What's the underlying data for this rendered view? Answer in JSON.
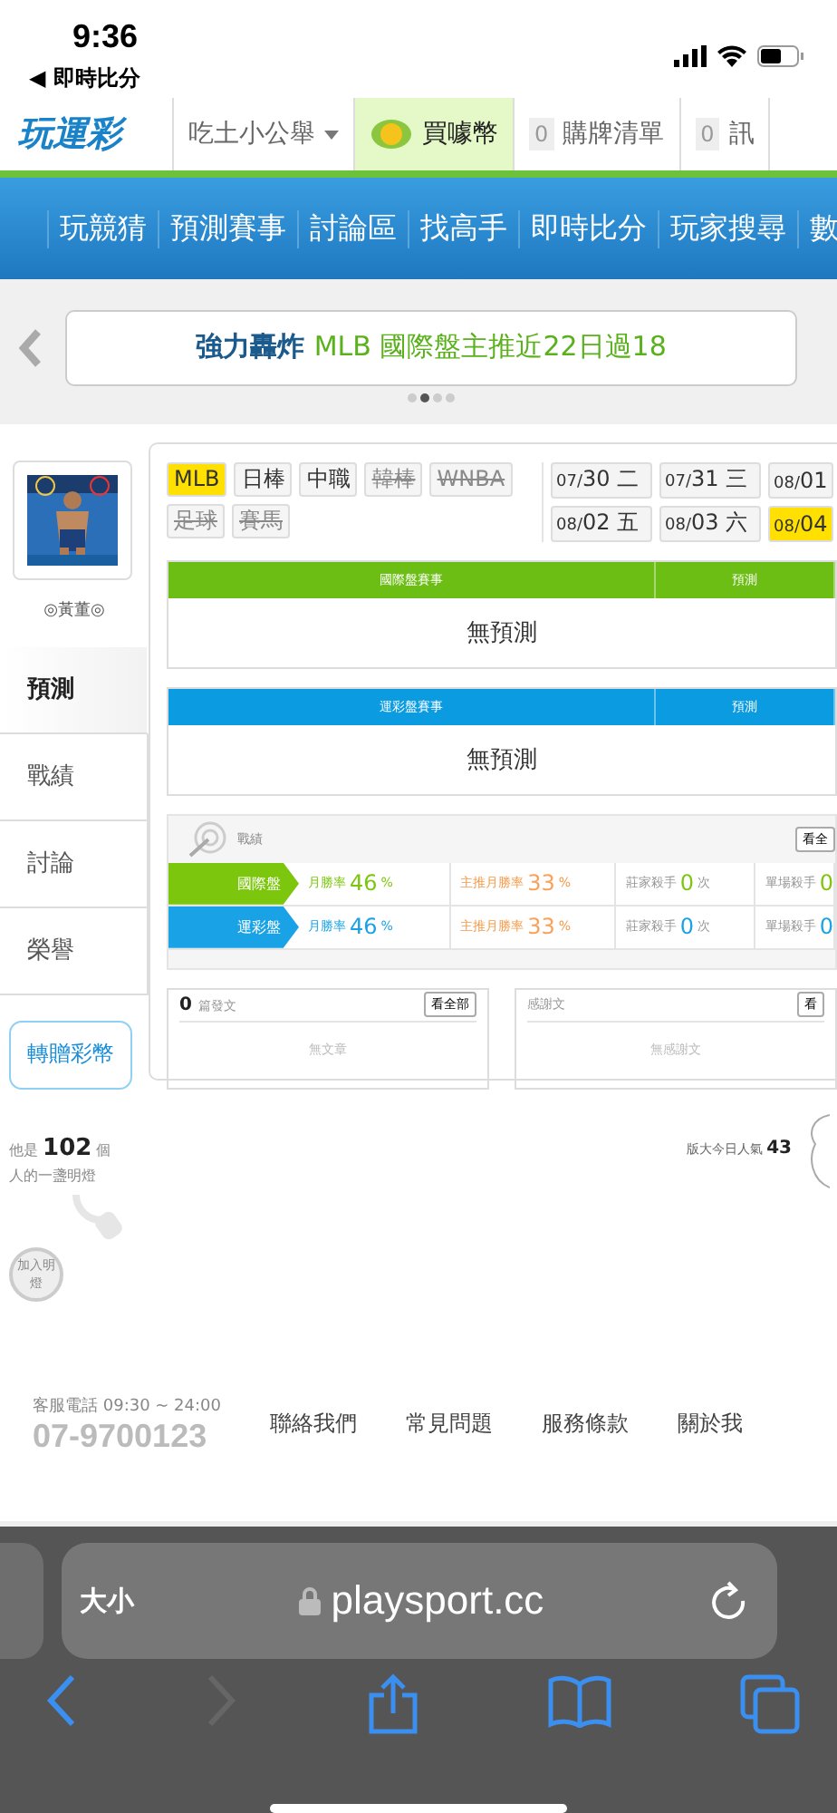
{
  "status_bar": {
    "time": "9:36",
    "back_link": "◀ 即時比分"
  },
  "top_nav": {
    "logo": "玩運彩",
    "user_menu": "吃土小公舉",
    "buy_coins": "買噱幣",
    "items": [
      {
        "count": "0",
        "label": "購牌清單"
      },
      {
        "count": "0",
        "label": "訊"
      }
    ]
  },
  "main_menu": [
    "玩競猜",
    "預測賽事",
    "討論區",
    "找高手",
    "即時比分",
    "玩家搜尋",
    "數"
  ],
  "banner": {
    "lead": "強力轟炸",
    "highlight": "MLB 國際盤主推近22日過18",
    "pages": [
      {
        "selected": false
      },
      {
        "selected": true
      },
      {
        "selected": false
      },
      {
        "selected": false
      }
    ]
  },
  "profile": {
    "name": "◎黃董◎",
    "tabs": [
      {
        "label": "預測",
        "selected": true
      },
      {
        "label": "戰績",
        "selected": false
      },
      {
        "label": "討論",
        "selected": false
      },
      {
        "label": "榮譽",
        "selected": false
      }
    ],
    "gift_button": "轉贈彩幣",
    "fans_prefix": "他是",
    "fans_count": "102",
    "fans_unit": "個",
    "fans_suffix": "人的一盞明燈",
    "follow_button": "加入明燈"
  },
  "leagues": [
    {
      "label": "MLB",
      "selected": true,
      "disabled": false
    },
    {
      "label": "日棒",
      "selected": false,
      "disabled": false
    },
    {
      "label": "中職",
      "selected": false,
      "disabled": false
    },
    {
      "label": "韓棒",
      "selected": false,
      "disabled": true
    },
    {
      "label": "WNBA",
      "selected": false,
      "disabled": true
    },
    {
      "label": "足球",
      "selected": false,
      "disabled": true
    },
    {
      "label": "賽馬",
      "selected": false,
      "disabled": true
    }
  ],
  "dates": [
    {
      "month": "07/",
      "day": "30",
      "weekday": "二",
      "selected": false
    },
    {
      "month": "07/",
      "day": "31",
      "weekday": "三",
      "selected": false
    },
    {
      "month": "08/",
      "day": "01",
      "selected": false
    },
    {
      "month": "08/",
      "day": "02",
      "weekday": "五",
      "selected": false
    },
    {
      "month": "08/",
      "day": "03",
      "weekday": "六",
      "selected": false
    },
    {
      "month": "08/",
      "day": "04",
      "selected": true
    }
  ],
  "prediction_tables": [
    {
      "title": "國際盤賽事",
      "column_2": "預測",
      "empty": "無預測",
      "color": "#6cbd14"
    },
    {
      "title": "運彩盤賽事",
      "column_2": "預測",
      "empty": "無預測",
      "color": "#0a9be0"
    }
  ],
  "record": {
    "title": "戰績",
    "view_all": "看全",
    "rows": [
      {
        "label": "國際盤",
        "color": "#7cc70e",
        "cells": [
          {
            "label": "月勝率",
            "value": "46",
            "unit": "%"
          },
          {
            "label": "主推月勝率",
            "value": "33",
            "unit": "%"
          },
          {
            "label": "莊家殺手",
            "value": "0",
            "unit": "次"
          },
          {
            "label": "單場殺手",
            "value": "0"
          }
        ]
      },
      {
        "label": "運彩盤",
        "color": "#1aa2e6",
        "cells": [
          {
            "label": "月勝率",
            "value": "46",
            "unit": "%"
          },
          {
            "label": "主推月勝率",
            "value": "33",
            "unit": "%"
          },
          {
            "label": "莊家殺手",
            "value": "0",
            "unit": "次"
          },
          {
            "label": "單場殺手",
            "value": "0"
          }
        ]
      }
    ]
  },
  "posts": [
    {
      "count": "0",
      "title": "篇發文",
      "view_all": "看全部",
      "empty": "無文章"
    },
    {
      "title": "感謝文",
      "view_all": "看",
      "empty": "無感謝文"
    }
  ],
  "popularity": {
    "label": "版大今日人氣",
    "value": "43"
  },
  "footer": {
    "hotline_label": "客服電話 09:30 ~ 24:00",
    "phone": "07-9700123",
    "links": [
      "聯絡我們",
      "常見問題",
      "服務條款",
      "關於我"
    ]
  },
  "browser": {
    "text_size": "大小",
    "url": "playsport.cc",
    "forward_disabled": true
  }
}
